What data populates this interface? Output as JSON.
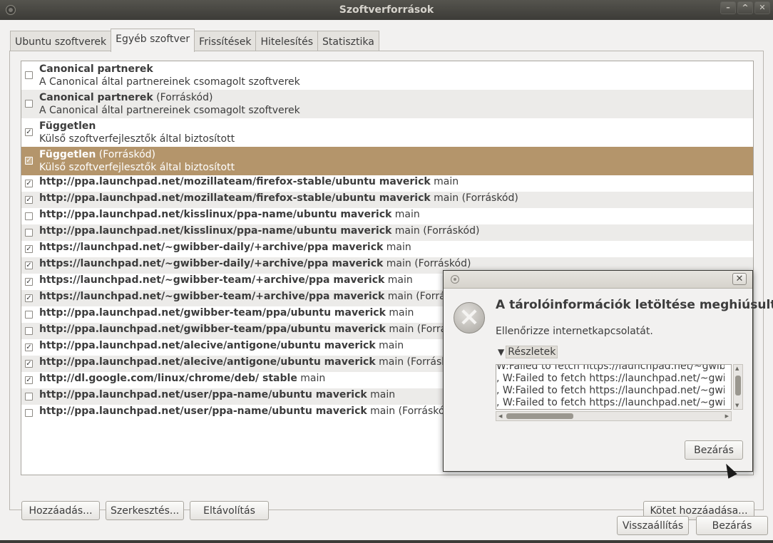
{
  "window": {
    "title": "Szoftverforrások",
    "controls": [
      "–",
      "^",
      "✕"
    ]
  },
  "tabs": [
    {
      "label": "Ubuntu szoftverek",
      "active": false
    },
    {
      "label": "Egyéb szoftver",
      "active": true
    },
    {
      "label": "Frissítések",
      "active": false
    },
    {
      "label": "Hitelesítés",
      "active": false
    },
    {
      "label": "Statisztika",
      "active": false
    }
  ],
  "sources": [
    {
      "name": "Canonical partnerek",
      "suffix": "",
      "desc": "A Canonical által partnereinek csomagolt szoftverek",
      "checked": false
    },
    {
      "name": "Canonical partnerek",
      "suffix": " (Forráskód)",
      "desc": "A Canonical által partnereinek csomagolt szoftverek",
      "checked": false
    },
    {
      "name": "Független",
      "suffix": "",
      "desc": "Külső szoftverfejlesztők által biztosított",
      "checked": true
    },
    {
      "name": "Független",
      "suffix": " (Forráskód)",
      "desc": "Külső szoftverfejlesztők által biztosított",
      "checked": true,
      "selected": true
    },
    {
      "name": "http://ppa.launchpad.net/mozillateam/firefox-stable/ubuntu maverick",
      "suffix": " main",
      "checked": true
    },
    {
      "name": "http://ppa.launchpad.net/mozillateam/firefox-stable/ubuntu maverick",
      "suffix": " main (Forráskód)",
      "checked": true
    },
    {
      "name": "http://ppa.launchpad.net/kisslinux/ppa-name/ubuntu maverick",
      "suffix": " main",
      "checked": false
    },
    {
      "name": "http://ppa.launchpad.net/kisslinux/ppa-name/ubuntu maverick",
      "suffix": " main (Forráskód)",
      "checked": false
    },
    {
      "name": "https://launchpad.net/~gwibber-daily/+archive/ppa maverick",
      "suffix": " main",
      "checked": true
    },
    {
      "name": "https://launchpad.net/~gwibber-daily/+archive/ppa maverick",
      "suffix": " main (Forráskód)",
      "checked": true
    },
    {
      "name": "https://launchpad.net/~gwibber-team/+archive/ppa maverick",
      "suffix": " main",
      "checked": true
    },
    {
      "name": "https://launchpad.net/~gwibber-team/+archive/ppa maverick",
      "suffix": " main (Forráskód)",
      "checked": true
    },
    {
      "name": "http://ppa.launchpad.net/gwibber-team/ppa/ubuntu maverick",
      "suffix": " main",
      "checked": false
    },
    {
      "name": "http://ppa.launchpad.net/gwibber-team/ppa/ubuntu maverick",
      "suffix": " main (Forráskód)",
      "checked": false
    },
    {
      "name": "http://ppa.launchpad.net/alecive/antigone/ubuntu maverick",
      "suffix": " main",
      "checked": true
    },
    {
      "name": "http://ppa.launchpad.net/alecive/antigone/ubuntu maverick",
      "suffix": " main (Forráskód)",
      "checked": true
    },
    {
      "name": "http://dl.google.com/linux/chrome/deb/ stable",
      "suffix": " main",
      "checked": true
    },
    {
      "name": "http://ppa.launchpad.net/user/ppa-name/ubuntu maverick",
      "suffix": " main",
      "checked": false
    },
    {
      "name": "http://ppa.launchpad.net/user/ppa-name/ubuntu maverick",
      "suffix": " main (Forráskód)",
      "checked": false
    }
  ],
  "buttons": {
    "add": "Hozzáadás...",
    "edit": "Szerkesztés...",
    "remove": "Eltávolítás",
    "add_volume": "Kötet hozzáadása...",
    "revert": "Visszaállítás",
    "close": "Bezárás"
  },
  "dialog": {
    "close_glyph": "✕",
    "heading": "A tárolóinformációk letöltése meghiúsult",
    "message": "Ellenőrizze internetkapcsolatát.",
    "expander_arrow": "▼",
    "expander_label": "Részletek",
    "details": [
      "W:Failed to fetch https://launchpad.net/~gwibbe",
      ", W:Failed to fetch https://launchpad.net/~gwibb",
      ", W:Failed to fetch https://launchpad.net/~gwibb",
      ", W:Failed to fetch https://launchpad.net/~gwibb"
    ],
    "close_button": "Bezárás"
  },
  "icons": {
    "window_menu": "window-menu-icon",
    "error": "error-icon",
    "checkmark": "✓"
  }
}
